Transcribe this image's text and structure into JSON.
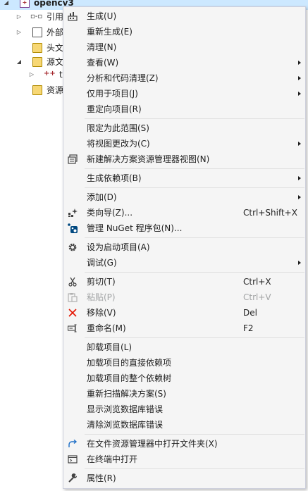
{
  "tree": {
    "items": [
      {
        "label": "opencv3"
      },
      {
        "label": "引用"
      },
      {
        "label": "外部"
      },
      {
        "label": "头文"
      },
      {
        "label": "源文"
      },
      {
        "label": "t"
      },
      {
        "label": "资源"
      }
    ]
  },
  "menu": {
    "items": [
      {
        "label": "生成(U)",
        "icon": "build-icon"
      },
      {
        "label": "重新生成(E)"
      },
      {
        "label": "清理(N)"
      },
      {
        "label": "查看(W)"
      },
      {
        "label": "分析和代码清理(Z)"
      },
      {
        "label": "仅用于项目(J)"
      },
      {
        "label": "重定向项目(R)"
      },
      {
        "label": "限定为此范围(S)"
      },
      {
        "label": "将视图更改为(C)"
      },
      {
        "label": "新建解决方案资源管理器视图(N)",
        "icon": "new-view-icon"
      },
      {
        "label": "生成依赖项(B)"
      },
      {
        "label": "添加(D)"
      },
      {
        "label": "类向导(Z)...",
        "shortcut": "Ctrl+Shift+X",
        "icon": "class-wizard-icon"
      },
      {
        "label": "管理 NuGet 程序包(N)...",
        "icon": "nuget-icon"
      },
      {
        "label": "设为启动项目(A)",
        "icon": "gear-icon"
      },
      {
        "label": "调试(G)"
      },
      {
        "label": "剪切(T)",
        "shortcut": "Ctrl+X",
        "icon": "scissors-icon"
      },
      {
        "label": "粘贴(P)",
        "shortcut": "Ctrl+V",
        "icon": "paste-icon"
      },
      {
        "label": "移除(V)",
        "shortcut": "Del",
        "icon": "remove-x-icon"
      },
      {
        "label": "重命名(M)",
        "shortcut": "F2",
        "icon": "rename-icon"
      },
      {
        "label": "卸载项目(L)"
      },
      {
        "label": "加载项目的直接依赖项"
      },
      {
        "label": "加载项目的整个依赖树"
      },
      {
        "label": "重新扫描解决方案(S)"
      },
      {
        "label": "显示浏览数据库错误"
      },
      {
        "label": "清除浏览数据库错误"
      },
      {
        "label": "在文件资源管理器中打开文件夹(X)",
        "icon": "open-folder-arrow-icon"
      },
      {
        "label": "在终端中打开",
        "icon": "terminal-icon"
      },
      {
        "label": "属性(R)",
        "icon": "wrench-icon"
      }
    ]
  },
  "colors": {
    "menu_bg": "#f5f5f5",
    "selected_row": "#cce8ff",
    "disabled_text": "#a2a4a5",
    "remove_icon": "#e51400",
    "nuget_blue": "#004880"
  }
}
